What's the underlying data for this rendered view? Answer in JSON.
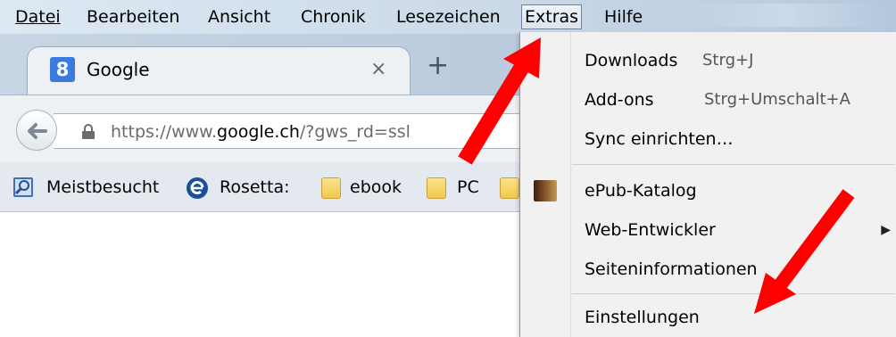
{
  "menubar": {
    "items": [
      {
        "label": "Datei"
      },
      {
        "label": "Bearbeiten"
      },
      {
        "label": "Ansicht"
      },
      {
        "label": "Chronik"
      },
      {
        "label": "Lesezeichen"
      },
      {
        "label": "Extras"
      },
      {
        "label": "Hilfe"
      }
    ],
    "open_item": "Extras"
  },
  "tab": {
    "favicon_letter": "8",
    "title": "Google",
    "close_glyph": "×",
    "new_tab_glyph": "+"
  },
  "navbar": {
    "url_prefix": "https://www.",
    "url_domain": "google.ch",
    "url_suffix": "/?gws_rd=ssl"
  },
  "bookmarks": {
    "items": [
      {
        "label": "Meistbesucht",
        "icon": "search-page-icon"
      },
      {
        "label": "Rosetta:",
        "icon": "rosetta-icon"
      },
      {
        "label": "ebook",
        "icon": "folder-icon"
      },
      {
        "label": "PC",
        "icon": "folder-icon"
      }
    ]
  },
  "extras_menu": {
    "items": [
      {
        "label": "Downloads",
        "shortcut": "Strg+J"
      },
      {
        "label": "Add-ons",
        "shortcut": "Strg+Umschalt+A"
      },
      {
        "label": "Sync einrichten…",
        "shortcut": ""
      },
      {
        "label": "ePub-Katalog",
        "shortcut": "",
        "icon": "book-icon"
      },
      {
        "label": "Web-Entwickler",
        "shortcut": "",
        "submenu": true
      },
      {
        "label": "Seiteninformationen",
        "shortcut": ""
      },
      {
        "label": "Einstellungen",
        "shortcut": ""
      }
    ]
  },
  "annotations": {
    "arrow_color": "#ff0000",
    "arrows": [
      {
        "target": "Extras"
      },
      {
        "target": "Einstellungen"
      }
    ]
  },
  "colors": {
    "menubar": "#cbd9e8",
    "toolbar": "#eef1f4",
    "menu_background": "#f1f1f1",
    "favicon": "#3a7be0"
  }
}
